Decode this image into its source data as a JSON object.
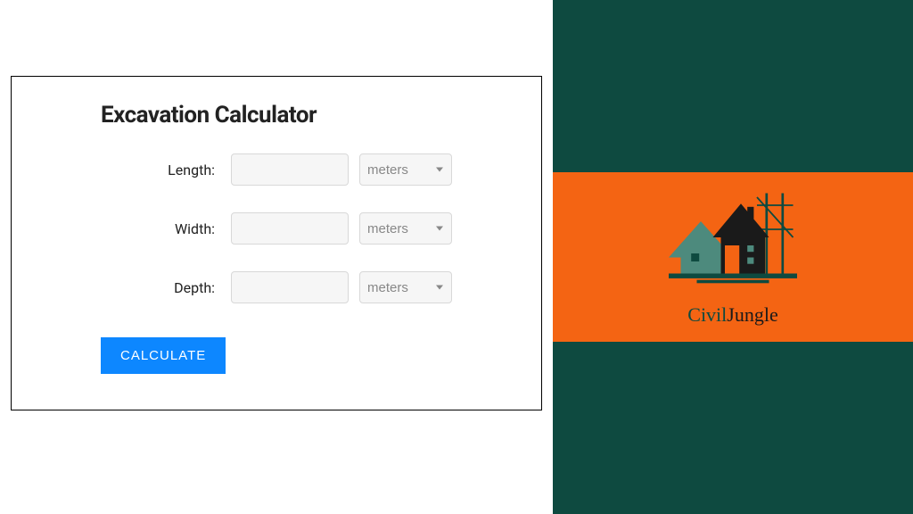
{
  "calculator": {
    "title": "Excavation Calculator",
    "fields": {
      "length": {
        "label": "Length:",
        "unit": "meters"
      },
      "width": {
        "label": "Width:",
        "unit": "meters"
      },
      "depth": {
        "label": "Depth:",
        "unit": "meters"
      }
    },
    "button_label": "CALCULATE"
  },
  "brand": {
    "civil": "Civil",
    "jungle": "Jungle"
  },
  "colors": {
    "sidebar_bg": "#0e4a40",
    "band_bg": "#f46413",
    "button_bg": "#0d87ff"
  }
}
